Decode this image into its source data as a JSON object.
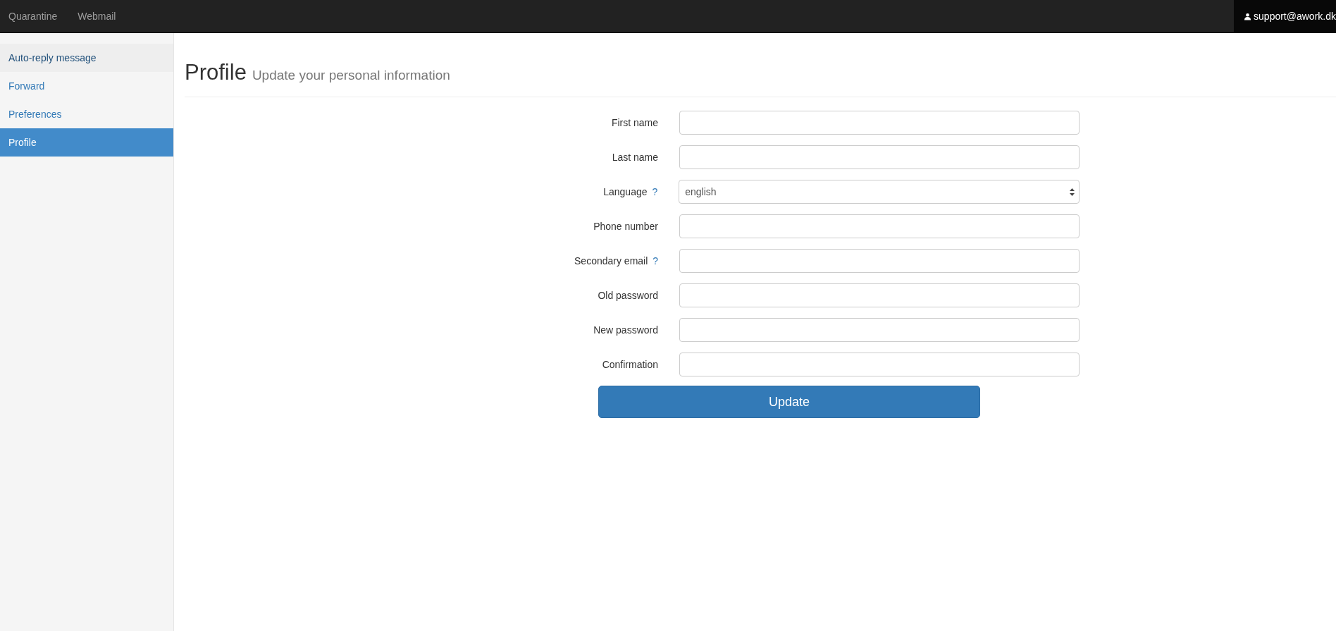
{
  "navbar": {
    "links": [
      "Quarantine",
      "Webmail"
    ],
    "user": "support@awork.dk"
  },
  "sidebar": {
    "items": [
      {
        "label": "Auto-reply message",
        "selected": false,
        "highlighted": true
      },
      {
        "label": "Forward",
        "selected": false,
        "highlighted": false
      },
      {
        "label": "Preferences",
        "selected": false,
        "highlighted": false
      },
      {
        "label": "Profile",
        "selected": true,
        "highlighted": false
      }
    ]
  },
  "page": {
    "title": "Profile",
    "subtitle": "Update your personal information"
  },
  "form": {
    "fields": [
      {
        "kind": "text",
        "label": "First name"
      },
      {
        "kind": "text",
        "label": "Last name"
      },
      {
        "kind": "select",
        "label": "Language",
        "help": "?",
        "value": "english"
      },
      {
        "kind": "text",
        "label": "Phone number"
      },
      {
        "kind": "text",
        "label": "Secondary email",
        "help": "?"
      },
      {
        "kind": "password",
        "label": "Old password"
      },
      {
        "kind": "password",
        "label": "New password"
      },
      {
        "kind": "password",
        "label": "Confirmation"
      }
    ],
    "submit": "Update"
  }
}
